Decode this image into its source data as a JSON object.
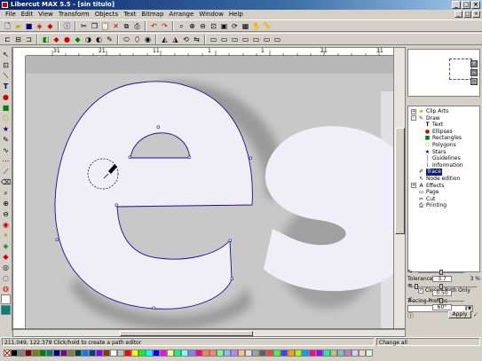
{
  "title": "Libercut MAX 5.5 - [sin titulo]",
  "window_controls": [
    "_",
    "□",
    "×"
  ],
  "menu": [
    "File",
    "Edit",
    "View",
    "Transform",
    "Objects",
    "Text",
    "Bitmap",
    "Arrange",
    "Window",
    "Help"
  ],
  "mdi_controls": [
    "_",
    "□",
    "×"
  ],
  "ruler_top": [
    "31",
    "21",
    "11",
    "1",
    "1",
    "21",
    "31"
  ],
  "tree": {
    "items": [
      {
        "label": "Clip Arts",
        "icon": "folder-icon",
        "level": 0,
        "expander": "+"
      },
      {
        "label": "Draw",
        "icon": "pencil-icon",
        "level": 0,
        "expander": "-"
      },
      {
        "label": "Text",
        "icon": "text-icon",
        "level": 1
      },
      {
        "label": "Ellipses",
        "icon": "ellipse-icon",
        "level": 1
      },
      {
        "label": "Rectangles",
        "icon": "rectangle-icon",
        "level": 1
      },
      {
        "label": "Polygons",
        "icon": "polygon-icon",
        "level": 1
      },
      {
        "label": "Stars",
        "icon": "star-icon",
        "level": 1
      },
      {
        "label": "Guidelines",
        "icon": "guideline-icon",
        "level": 1
      },
      {
        "label": "Information",
        "icon": "info-icon",
        "level": 1
      },
      {
        "label": "Trace",
        "icon": "trace-icon",
        "level": 0,
        "selected": true
      },
      {
        "label": "Node edition",
        "icon": "node-icon",
        "level": 0
      },
      {
        "label": "Effects",
        "icon": "effects-icon",
        "level": 0,
        "expander": "+"
      },
      {
        "label": "Page",
        "icon": "page-icon",
        "level": 0
      },
      {
        "label": "Cut",
        "icon": "scissors-icon",
        "level": 0
      },
      {
        "label": "Printing",
        "icon": "printer-icon",
        "level": 0
      }
    ]
  },
  "params": {
    "tolerance_label": "Tolerance",
    "tolerance_value": "3 %",
    "closed_paths_label": "Closed Path Only",
    "closed_paths_checked": true,
    "profile_label": "Tracing Profiles",
    "profile_value": "",
    "smooth_value": "3.7",
    "detail_value": "0.50",
    "angle_value": "60°",
    "apply_label": "Apply"
  },
  "status": {
    "coords": "211.049, 122.379  Click/hold to create a path editor",
    "mode": "Change all"
  },
  "palette": [
    "#000000",
    "#808080",
    "#800000",
    "#808000",
    "#008000",
    "#008080",
    "#000080",
    "#800080",
    "#808040",
    "#004040",
    "#0080ff",
    "#004080",
    "#8000ff",
    "#804000",
    "#ffffff",
    "#c0c0c0",
    "#ff0000",
    "#ffff00",
    "#00ff00",
    "#00ffff",
    "#0000ff",
    "#ff00ff",
    "#ffff80",
    "#00ff80",
    "#80ffff",
    "#8080ff",
    "#ff0080",
    "#ff8040",
    "#ff8080",
    "#80ff80",
    "#80c0ff",
    "#c080ff",
    "#ffc080",
    "#e0e0e0",
    "#a0a0a0",
    "#606060",
    "#ff4040",
    "#40ff40",
    "#4040ff",
    "#ffa000",
    "#a0ff00",
    "#00a0ff",
    "#ff00a0",
    "#a000ff",
    "#00ffa0",
    "#c0c080",
    "#80c0c0",
    "#c080c0",
    "#d0d0ff",
    "#ffd0d0",
    "#d0ffd0"
  ]
}
